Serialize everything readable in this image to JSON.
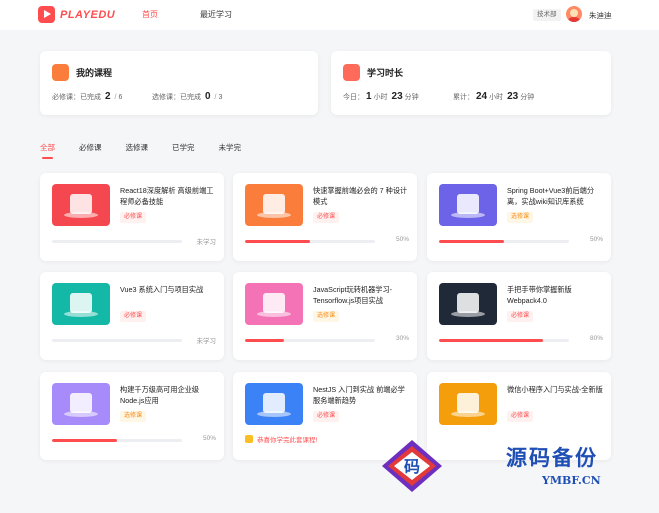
{
  "header": {
    "logo_text": "PLAYEDU",
    "nav": [
      "首页",
      "最近学习"
    ],
    "department": "技术部",
    "username": "朱迪迪"
  },
  "stats": {
    "courses": {
      "title": "我的课程",
      "required_label": "必修课：已完成",
      "required_done": "2",
      "required_total": "6",
      "elective_label": "选修课：已完成",
      "elective_done": "0",
      "elective_total": "3",
      "sep": "/"
    },
    "time": {
      "title": "学习时长",
      "today_label": "今日：",
      "today_hours": "1",
      "today_minutes": "23",
      "total_label": "累计：",
      "total_hours": "24",
      "total_minutes": "23",
      "hour_unit": "小时",
      "minute_unit": "分钟"
    }
  },
  "filters": [
    "全部",
    "必修课",
    "选修课",
    "已学完",
    "未学完"
  ],
  "courses": [
    {
      "title": "React18深度解析 高级前端工程师必备技能",
      "tag": "必修课",
      "progress": 0,
      "status": "未学习",
      "color": "#f5474f"
    },
    {
      "title": "快速掌握前端必会的 7 种设计模式",
      "tag": "必修课",
      "progress": 50,
      "status": "50%",
      "color": "#fb7d3c"
    },
    {
      "title": "Spring Boot+Vue3前后端分离，实战wiki知识库系统",
      "tag": "选修课",
      "progress": 50,
      "status": "50%",
      "color": "#6c63e8"
    },
    {
      "title": "Vue3 系统入门与项目实战",
      "tag": "必修课",
      "progress": 0,
      "status": "未学习",
      "color": "#14b8a6"
    },
    {
      "title": "JavaScript玩转机器学习-Tensorflow.js项目实战",
      "tag": "选修课",
      "progress": 30,
      "status": "30%",
      "color": "#f472b6"
    },
    {
      "title": "手把手带你掌握新版Webpack4.0",
      "tag": "必修课",
      "progress": 80,
      "status": "80%",
      "color": "#1f2937"
    },
    {
      "title": "构建千万级高可用企业级Node.js应用",
      "tag": "选修课",
      "progress": 50,
      "status": "50%",
      "color": "#a78bfa"
    },
    {
      "title": "NestJS 入门到实战 前端必学服务端新趋势",
      "tag": "必修课",
      "progress": 100,
      "status": "恭喜你学完此套课程!",
      "color": "#3b82f6"
    },
    {
      "title": "微信小程序入门与实战-全新版",
      "tag": "必修课",
      "progress": 0,
      "status": "",
      "color": "#f59e0b"
    }
  ],
  "watermark": {
    "glyph": "码",
    "text": "源码备份",
    "url": "YMBF.CN"
  },
  "colors": {
    "accent": "#ff4d4f",
    "elective": "#fa8c16"
  }
}
